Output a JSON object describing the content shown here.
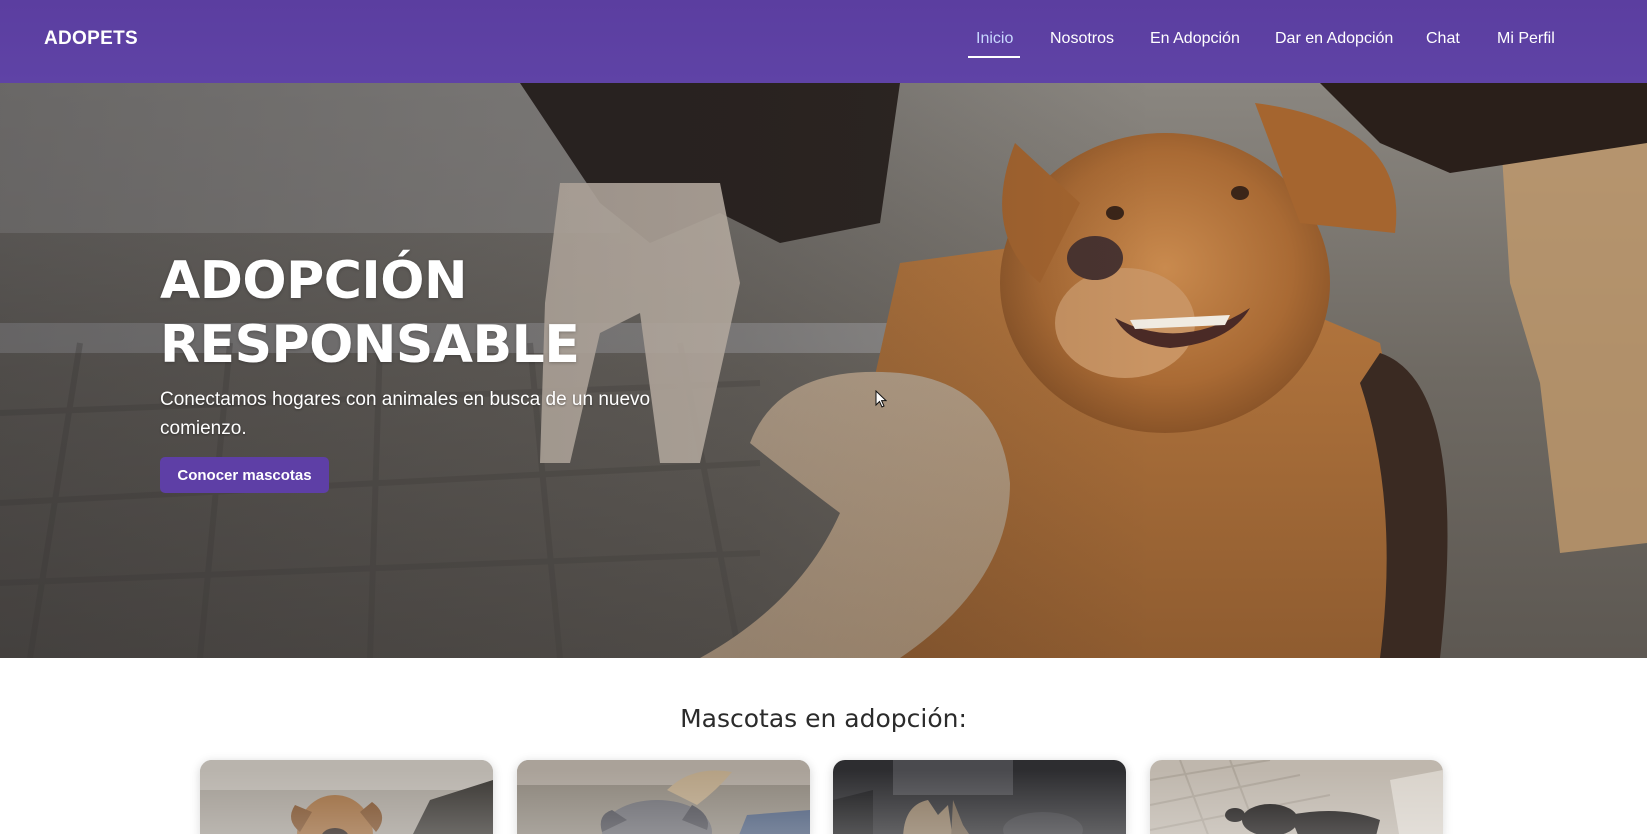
{
  "navbar": {
    "brand": "ADOPETS",
    "links": [
      {
        "label": "Inicio",
        "active": true
      },
      {
        "label": "Nosotros",
        "active": false
      },
      {
        "label": "En Adopción",
        "active": false
      },
      {
        "label": "Dar en Adopción",
        "active": false
      },
      {
        "label": "Chat",
        "active": false
      },
      {
        "label": "Mi Perfil",
        "active": false
      }
    ]
  },
  "hero": {
    "title_line1": "ADOPCIÓN",
    "title_line2": "RESPONSABLE",
    "subtitle": "Conectamos hogares con animales en busca de un nuevo comienzo.",
    "button_label": "Conocer mascotas"
  },
  "pets": {
    "section_title": "Mascotas en adopción:"
  },
  "colors": {
    "brand_purple": "#5e3fa6",
    "nav_active": "#c9d8ff"
  }
}
